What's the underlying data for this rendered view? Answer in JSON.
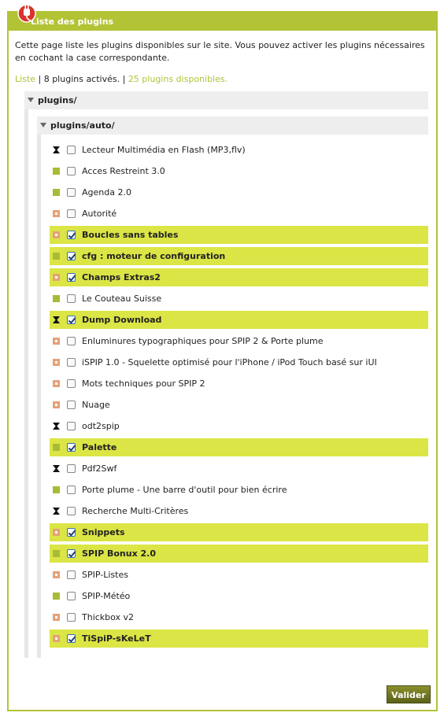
{
  "panel": {
    "title": "Liste des plugins",
    "intro": "Cette page liste les plugins disponibles sur le site. Vous pouvez activer les plugins nécessaires en cochant la case correspondante.",
    "links": {
      "list": "Liste",
      "sep1": " | ",
      "active": "8 plugins activés.",
      "sep2": " | ",
      "available": "25 plugins disponibles."
    },
    "folder_root": "plugins/",
    "folder_sub": "plugins/auto/",
    "submit": "Valider"
  },
  "plugins": [
    {
      "name": "Lecteur Multimédia en Flash (MP3,flv)",
      "icon": "hourglass-icon",
      "checked": false
    },
    {
      "name": "Acces Restreint 3.0",
      "icon": "square-icon",
      "checked": false
    },
    {
      "name": "Agenda 2.0",
      "icon": "square-icon",
      "checked": false
    },
    {
      "name": "Autorité",
      "icon": "dotted-icon",
      "checked": false
    },
    {
      "name": "Boucles sans tables",
      "icon": "dotted-icon",
      "checked": true
    },
    {
      "name": "cfg : moteur de configuration",
      "icon": "square-icon",
      "checked": true
    },
    {
      "name": "Champs Extras2",
      "icon": "dotted-icon",
      "checked": true
    },
    {
      "name": "Le Couteau Suisse",
      "icon": "square-icon",
      "checked": false
    },
    {
      "name": "Dump Download",
      "icon": "hourglass-icon",
      "checked": true
    },
    {
      "name": "Enluminures typographiques pour SPIP 2 & Porte plume",
      "icon": "dotted-icon",
      "checked": false
    },
    {
      "name": "iSPIP 1.0 - Squelette optimisé pour l'iPhone / iPod Touch basé sur iUI",
      "icon": "dotted-icon",
      "checked": false
    },
    {
      "name": "Mots techniques pour SPIP 2",
      "icon": "dotted-icon",
      "checked": false
    },
    {
      "name": "Nuage",
      "icon": "dotted-icon",
      "checked": false
    },
    {
      "name": "odt2spip",
      "icon": "hourglass-icon",
      "checked": false
    },
    {
      "name": "Palette",
      "icon": "square-icon",
      "checked": true
    },
    {
      "name": "Pdf2Swf",
      "icon": "hourglass-icon",
      "checked": false
    },
    {
      "name": "Porte plume - Une barre d'outil pour bien écrire",
      "icon": "square-icon",
      "checked": false
    },
    {
      "name": "Recherche Multi-Critères",
      "icon": "hourglass-icon",
      "checked": false
    },
    {
      "name": "Snippets",
      "icon": "dotted-icon",
      "checked": true
    },
    {
      "name": "SPIP Bonux 2.0",
      "icon": "square-icon",
      "checked": true
    },
    {
      "name": "SPIP-Listes",
      "icon": "dotted-icon",
      "checked": false
    },
    {
      "name": "SPIP-Météo",
      "icon": "square-icon",
      "checked": false
    },
    {
      "name": "Thickbox v2",
      "icon": "dotted-icon",
      "checked": false
    },
    {
      "name": "TiSpiP-sKeLeT",
      "icon": "dotted-icon",
      "checked": true
    }
  ]
}
